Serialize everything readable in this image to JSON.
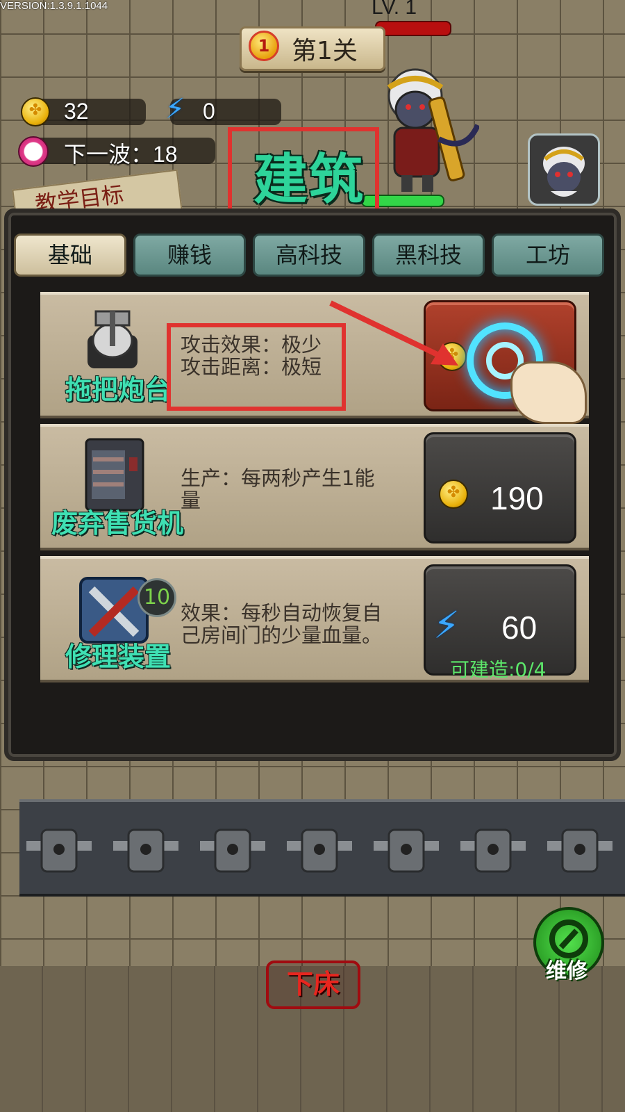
{
  "version": "VERSION:1.3.9.1.1044",
  "boss": {
    "level_label": "LV. 1"
  },
  "level": {
    "medal": "1",
    "name": "第1关"
  },
  "resources": {
    "coins": "32",
    "energy": "0",
    "next_wave_label": "下一波：18"
  },
  "tutorial_label": "教学目标",
  "build_title": "建筑",
  "tabs": [
    {
      "label": "基础",
      "active": true
    },
    {
      "label": "赚钱",
      "active": false
    },
    {
      "label": "高科技",
      "active": false
    },
    {
      "label": "黑科技",
      "active": false
    },
    {
      "label": "工坊",
      "active": false
    }
  ],
  "items": [
    {
      "name": "拖把炮台",
      "desc_line1": "攻击效果：极少",
      "desc_line2": "攻击距离：极短",
      "icon": "mop-turret-icon"
    },
    {
      "name": "废弃售货机",
      "desc_line1": "生产：每两秒产生1能",
      "desc_line2": "量",
      "price": "190",
      "currency": "coin",
      "icon": "vending-machine-icon"
    },
    {
      "name": "修理装置",
      "desc_line1": "效果：每秒自动恢复自",
      "desc_line2": "己房间门的少量血量。",
      "price": "60",
      "currency": "energy",
      "badge": "10",
      "limit": "可建造:0/4",
      "icon": "repair-tools-icon"
    }
  ],
  "repair_label": "维修",
  "bed_label": "下床",
  "colors": {
    "title_green": "#2ed49a",
    "highlight_red": "#e0322f",
    "limit_green": "#5ce66a"
  }
}
